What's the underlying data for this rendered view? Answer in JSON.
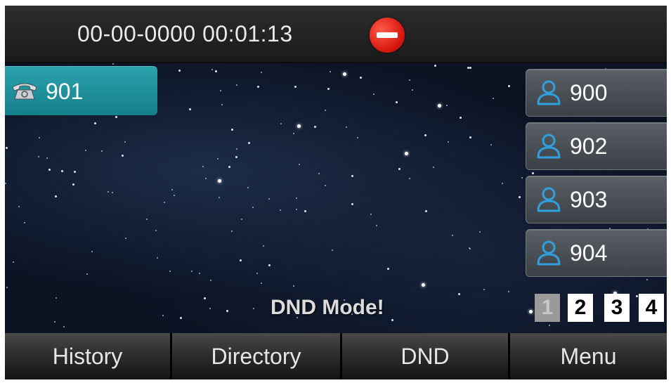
{
  "status_bar": {
    "datetime": "00-00-0000 00:01:13",
    "dnd_indicator_icon": "do-not-disturb-icon",
    "dnd_indicator_color": "#e0190f"
  },
  "line_key": {
    "label": "901",
    "icon": "telephone-icon",
    "color": "#1f95a0"
  },
  "blf_keys": [
    {
      "label": "900",
      "icon": "contact-icon"
    },
    {
      "label": "902",
      "icon": "contact-icon"
    },
    {
      "label": "903",
      "icon": "contact-icon"
    },
    {
      "label": "904",
      "icon": "contact-icon"
    }
  ],
  "status_message": "DND Mode!",
  "pages": {
    "items": [
      "1",
      "2",
      "3",
      "4"
    ],
    "active": "1"
  },
  "softkeys": {
    "history": "History",
    "directory": "Directory",
    "dnd": "DND",
    "menu": "Menu"
  },
  "colors": {
    "contact_icon": "#2fa0dc",
    "background": "#0b1222"
  }
}
